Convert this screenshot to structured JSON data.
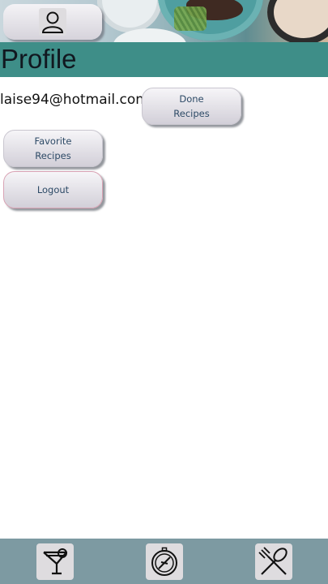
{
  "header": {
    "profile_icon": "profile-icon",
    "title": "Profile"
  },
  "user": {
    "email": "laise94@hotmail.com"
  },
  "buttons": {
    "done_recipes": "Done\nRecipes",
    "favorite_recipes": "Favorite\nRecipes",
    "logout": "Logout"
  },
  "footer": {
    "drinks_icon": "cocktail-icon",
    "explore_icon": "compass-icon",
    "foods_icon": "fork-spoon-icon"
  },
  "colors": {
    "title_bar": "#3e8e88",
    "footer": "#7d9aa2",
    "button_text": "#2d4a66"
  }
}
